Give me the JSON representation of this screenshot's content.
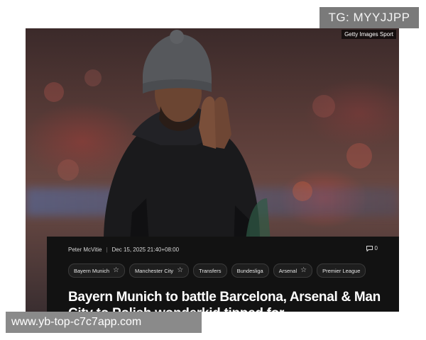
{
  "watermark": {
    "tg_label": "TG: MYYJJPP",
    "url_label": "www.yb-top-c7c7app.com"
  },
  "photo": {
    "credit": "Getty Images Sport"
  },
  "article": {
    "author": "Peter McVitie",
    "date": "Dec 15, 2025 21:40+08:00",
    "comment_count": "0",
    "tags": [
      {
        "label": "Bayern Munich",
        "starred": true
      },
      {
        "label": "Manchester City",
        "starred": true
      },
      {
        "label": "Transfers",
        "starred": false
      },
      {
        "label": "Bundesliga",
        "starred": false
      },
      {
        "label": "Arsenal",
        "starred": true
      },
      {
        "label": "Premier League",
        "starred": false
      }
    ],
    "headline": "Bayern Munich to battle Barcelona, Arsenal & Man City to Polish wonderkid tipped for"
  }
}
